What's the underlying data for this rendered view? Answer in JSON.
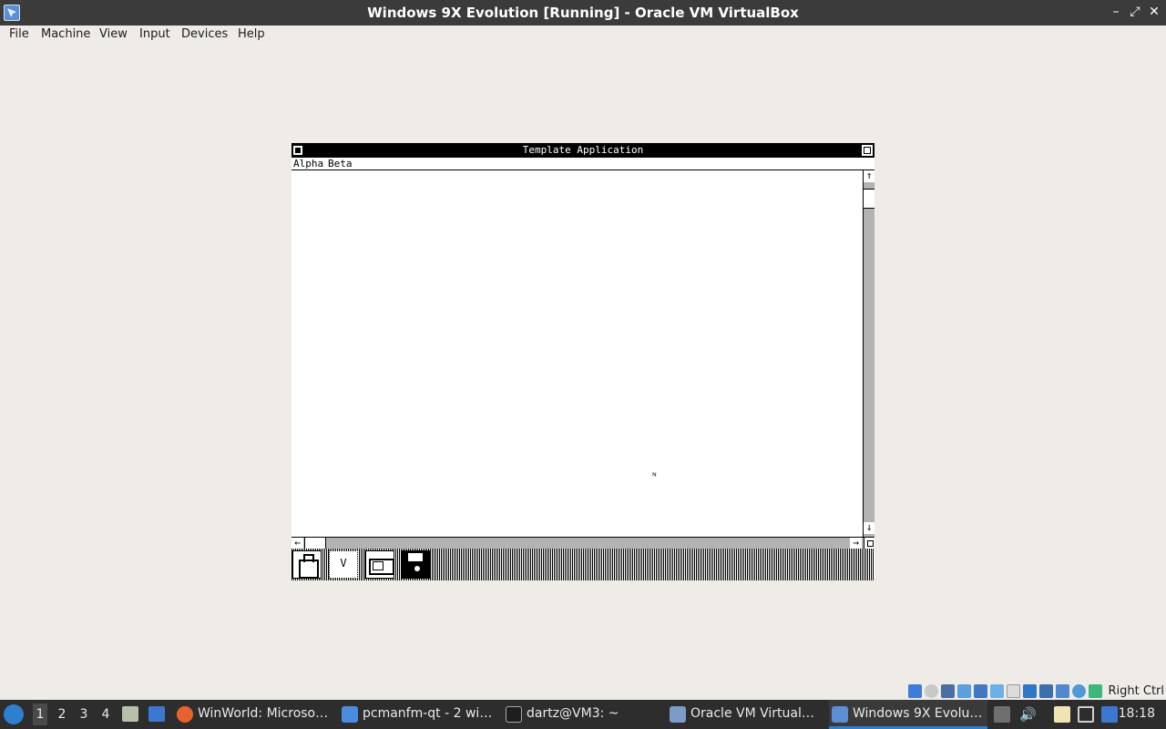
{
  "window": {
    "title": "Windows 9X Evolution [Running] - Oracle VM VirtualBox",
    "controls": {
      "minimize": "–",
      "maximize": "⤢",
      "close": "✕"
    }
  },
  "menubar": [
    "File",
    "Machine",
    "View",
    "Input",
    "Devices",
    "Help"
  ],
  "guest": {
    "title": "Template Application",
    "menu": [
      "Alpha",
      "Beta"
    ],
    "scroll": {
      "up": "↑",
      "down": "↓",
      "left": "←",
      "right": "→"
    },
    "dock_clock": "V",
    "cursor": "ᴺ"
  },
  "statusbar": {
    "icons": [
      "hard-disk-icon",
      "optical-drive-icon",
      "floppy-icon",
      "audio-icon",
      "network-icon",
      "usb-icon",
      "shared-folders-icon",
      "display-icon",
      "recording-icon",
      "cpu-icon",
      "mouse-integration-icon",
      "keyboard-icon"
    ],
    "host_key": "Right Ctrl"
  },
  "taskbar": {
    "workspaces": [
      "1",
      "2",
      "3",
      "4"
    ],
    "active_workspace": "1",
    "tasks": [
      {
        "label": "WinWorld: Microso…",
        "icon": "firefox-icon"
      },
      {
        "label": "pcmanfm-qt - 2 wi…",
        "icon": "folder-icon"
      },
      {
        "label": "dartz@VM3: ~",
        "icon": "terminal-icon"
      },
      {
        "label": "Oracle VM Virtual…",
        "icon": "virtualbox-icon"
      },
      {
        "label": "Windows 9X Evolu…",
        "icon": "vm-window-icon"
      }
    ],
    "clock": "18:18"
  },
  "colors": {
    "titlebar": "#3b3b3b",
    "desktop": "#efebe7",
    "taskbar": "#2d2d2d",
    "accent": "#2f7fd1"
  }
}
